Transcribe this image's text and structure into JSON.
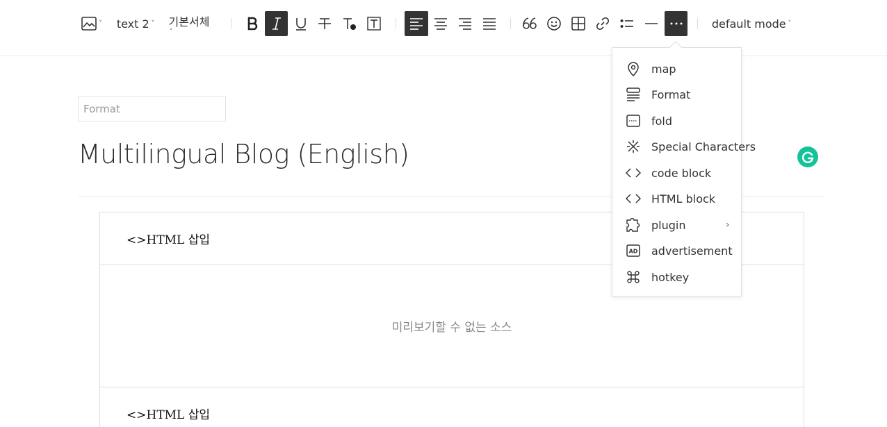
{
  "toolbar": {
    "font_size_label": "text 2",
    "font_family_label": "기본서체",
    "mode_label": "default mode",
    "chevron": "˅"
  },
  "editor": {
    "format_placeholder": "Format",
    "title": "Multilingual Blog (English)"
  },
  "blocks": [
    {
      "header": "<>HTML 삽입",
      "preview_text": "미리보기할 수 없는 소스"
    },
    {
      "header": "<>HTML 삽입"
    }
  ],
  "more_menu": {
    "items": [
      {
        "label": "map",
        "icon": "map-pin-icon"
      },
      {
        "label": "Format",
        "icon": "format-icon"
      },
      {
        "label": "fold",
        "icon": "fold-icon"
      },
      {
        "label": "Special Characters",
        "icon": "special-characters-icon"
      },
      {
        "label": "code block",
        "icon": "code-icon"
      },
      {
        "label": "HTML block",
        "icon": "html-icon"
      },
      {
        "label": "plugin",
        "icon": "plugin-icon",
        "submenu_arrow": "›"
      },
      {
        "label": "advertisement",
        "icon": "ad-icon",
        "badge": "AD"
      },
      {
        "label": "hotkey",
        "icon": "command-icon"
      }
    ]
  },
  "colors": {
    "active_button": "#333333",
    "grammarly": "#15c39a",
    "border": "#dcdcdc"
  }
}
